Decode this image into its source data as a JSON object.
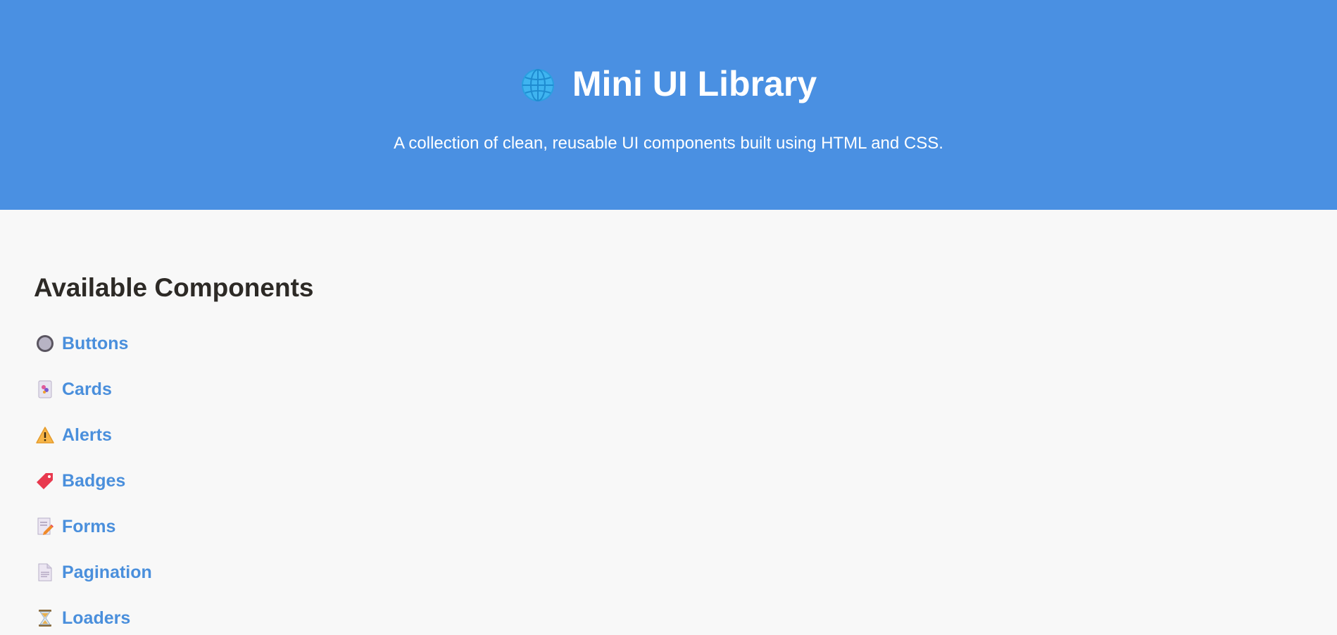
{
  "header": {
    "title": "Mini UI Library",
    "icon": "globe-icon",
    "subtitle": "A collection of clean, reusable UI components built using HTML and CSS."
  },
  "main": {
    "section_title": "Available Components",
    "components": [
      {
        "label": "Buttons",
        "icon": "radio-button-icon"
      },
      {
        "label": "Cards",
        "icon": "card-icon"
      },
      {
        "label": "Alerts",
        "icon": "warning-icon"
      },
      {
        "label": "Badges",
        "icon": "tag-icon"
      },
      {
        "label": "Forms",
        "icon": "memo-icon"
      },
      {
        "label": "Pagination",
        "icon": "page-icon"
      },
      {
        "label": "Loaders",
        "icon": "hourglass-icon"
      }
    ]
  },
  "colors": {
    "header_bg": "#4a90e2",
    "page_bg": "#f8f8f8",
    "link": "#4a8fdc",
    "heading": "#2d2a26"
  }
}
